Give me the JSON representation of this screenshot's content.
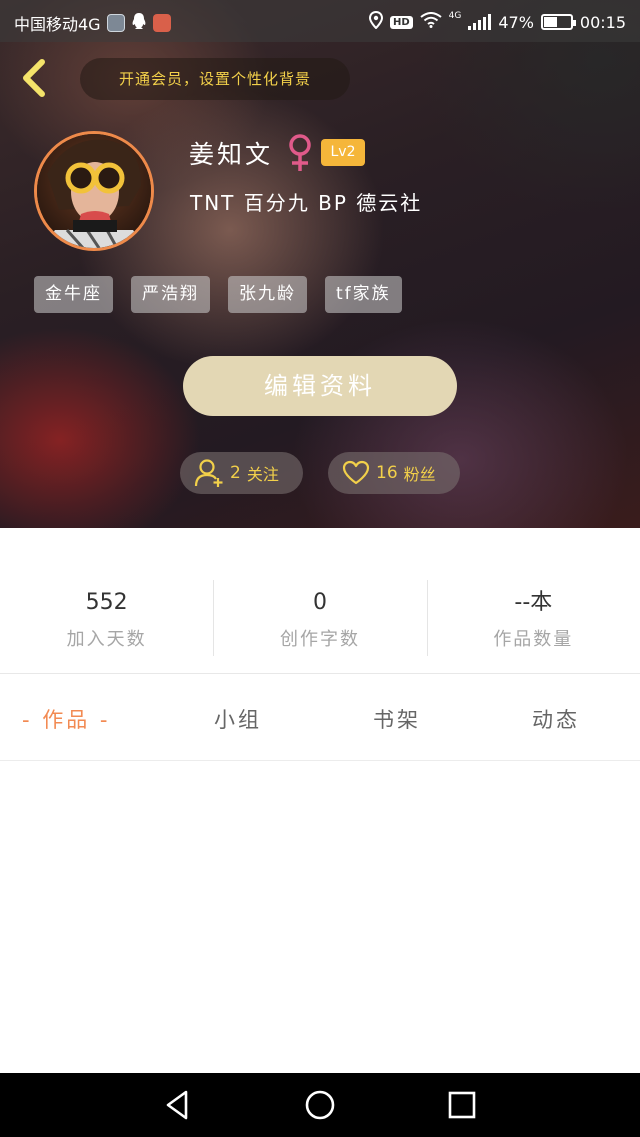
{
  "status_bar": {
    "carrier": "中国移动4G",
    "network_type": "4G",
    "battery": "47%",
    "battery_level": 0.47,
    "time": "00:15",
    "hd_label": "HD"
  },
  "header": {
    "vip_prompt": "开通会员，设置个性化背景"
  },
  "profile": {
    "username": "姜知文",
    "gender": "female",
    "level": "Lv2",
    "bio": "TNT  百分九  BP  德云社",
    "tags": [
      "金牛座",
      "严浩翔",
      "张九龄",
      "tf家族"
    ],
    "edit_label": "编辑资料",
    "following_count": "2",
    "following_label": "关注",
    "fans_count": "16",
    "fans_label": "粉丝"
  },
  "stats": [
    {
      "value": "552",
      "label": "加入天数"
    },
    {
      "value": "0",
      "label": "创作字数"
    },
    {
      "value": "--本",
      "label": "作品数量"
    }
  ],
  "tabs": [
    {
      "label": "- 作品 -",
      "active": true
    },
    {
      "label": "小组",
      "active": false
    },
    {
      "label": "书架",
      "active": false
    },
    {
      "label": "动态",
      "active": false
    }
  ],
  "colors": {
    "accent_gold": "#f2d04a",
    "tab_active": "#f28a52",
    "level_badge": "#f5b63a",
    "edit_button": "#e3d7b4",
    "female_icon": "#e05a8a"
  },
  "icons": {
    "back": "chevron-left-icon",
    "female": "female-icon",
    "following": "user-add-icon",
    "fans": "heart-icon",
    "nav_back": "triangle-back-icon",
    "nav_home": "circle-home-icon",
    "nav_recent": "square-recent-icon"
  }
}
